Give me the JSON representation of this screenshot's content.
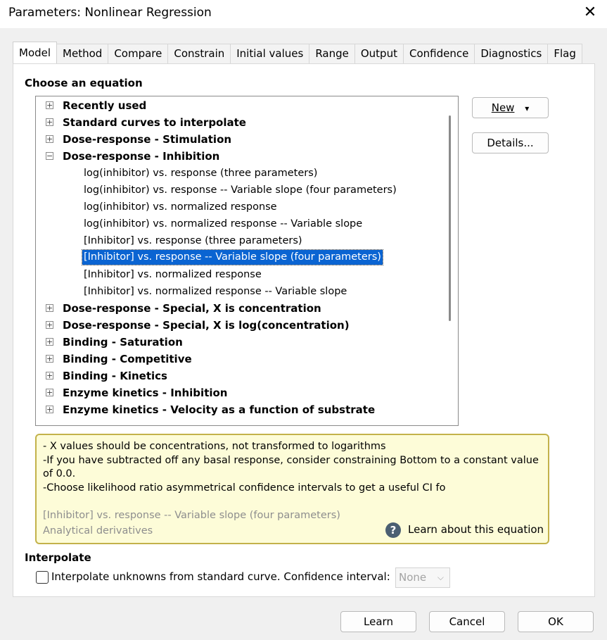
{
  "window": {
    "title": "Parameters: Nonlinear Regression",
    "close_glyph": "✕"
  },
  "tabs": [
    "Model",
    "Method",
    "Compare",
    "Constrain",
    "Initial values",
    "Range",
    "Output",
    "Confidence",
    "Diagnostics",
    "Flag"
  ],
  "section": {
    "choose": "Choose an equation",
    "interpolate": "Interpolate"
  },
  "tree": {
    "groups": [
      {
        "label": "Recently used",
        "expander": "+"
      },
      {
        "label": "Standard curves to interpolate",
        "expander": "+"
      },
      {
        "label": "Dose-response - Stimulation",
        "expander": "+"
      },
      {
        "label": "Dose-response - Inhibition",
        "expander": "−"
      },
      {
        "label": "Dose-response - Special, X is concentration",
        "expander": "+"
      },
      {
        "label": "Dose-response - Special, X is log(concentration)",
        "expander": "+"
      },
      {
        "label": "Binding - Saturation",
        "expander": "+"
      },
      {
        "label": "Binding - Competitive",
        "expander": "+"
      },
      {
        "label": "Binding - Kinetics",
        "expander": "+"
      },
      {
        "label": "Enzyme kinetics - Inhibition",
        "expander": "+"
      },
      {
        "label": "Enzyme kinetics - Velocity as a function of substrate",
        "expander": "+"
      }
    ],
    "items": [
      "log(inhibitor) vs. response (three parameters)",
      "log(inhibitor) vs. response -- Variable slope (four parameters)",
      "log(inhibitor) vs. normalized response",
      "log(inhibitor) vs. normalized response -- Variable slope",
      "[Inhibitor] vs. response (three parameters)",
      "[Inhibitor] vs. response -- Variable slope (four parameters)",
      "[Inhibitor] vs. normalized response",
      "[Inhibitor] vs. normalized response -- Variable slope"
    ]
  },
  "buttons": {
    "new": "New",
    "new_arrow": "▾",
    "details": "Details...",
    "learn": "Learn",
    "cancel": "Cancel",
    "ok": "OK"
  },
  "hint": {
    "line1": "- X values should be concentrations, not transformed to logarithms",
    "line2": "-If you have subtracted off any  basal response, consider constraining Bottom to a constant value",
    "line3": "of 0.0.",
    "line4": "-Choose likelihood ratio asymmetrical confidence intervals to get a useful CI fo",
    "equation": "[Inhibitor] vs. response -- Variable slope (four parameters)",
    "derivatives": "Analytical derivatives",
    "learn_icon": "?",
    "learn_link": "Learn about this equation"
  },
  "interpolate": {
    "checkbox_label": "Interpolate unknowns from standard curve. Confidence interval:",
    "select_value": "None",
    "select_arrow": "⌵"
  }
}
